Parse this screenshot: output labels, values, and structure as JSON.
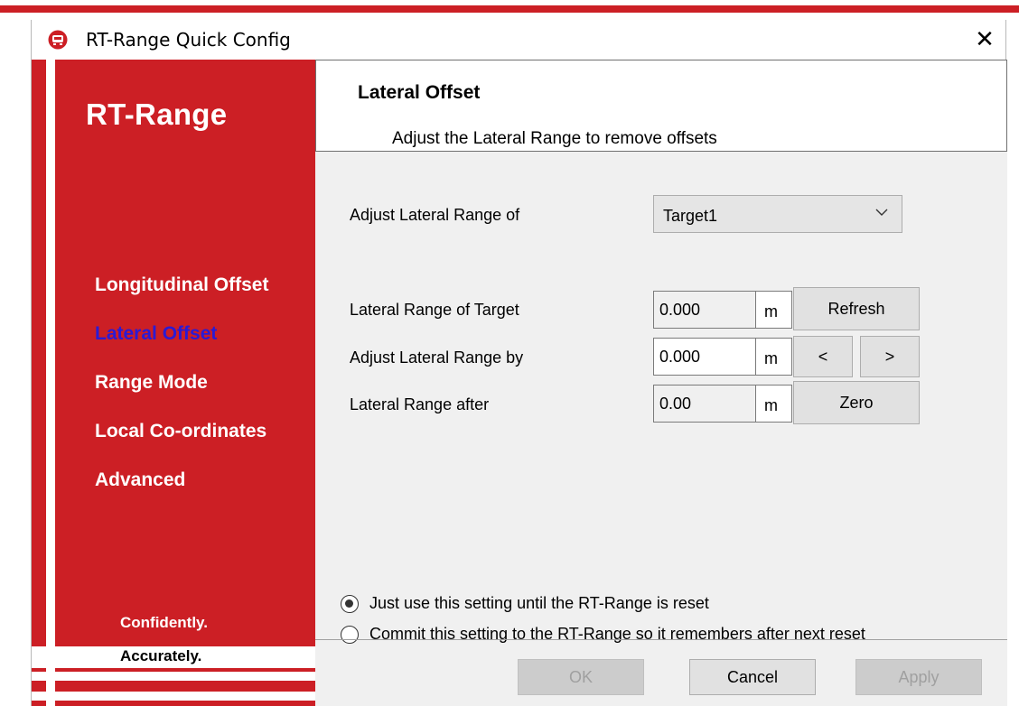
{
  "window": {
    "title": "RT-Range Quick Config",
    "close_glyph": "✕",
    "app_icon": "app-icon",
    "accent_color": "#cc1f25"
  },
  "sidebar": {
    "logo": "RT-Range",
    "items": [
      {
        "label": "Longitudinal Offset",
        "active": false
      },
      {
        "label": "Lateral Offset",
        "active": true
      },
      {
        "label": "Range Mode",
        "active": false
      },
      {
        "label": "Local Co-ordinates",
        "active": false
      },
      {
        "label": "Advanced",
        "active": false
      }
    ],
    "tagline_line1": "Confidently.",
    "tagline_line2": "Accurately.",
    "active_color": "#2b1ad4"
  },
  "header": {
    "title": "Lateral Offset",
    "subtitle": "Adjust the Lateral Range to remove offsets"
  },
  "form": {
    "target_label": "Adjust Lateral Range of",
    "target_value": "Target1",
    "rows": [
      {
        "label": "Lateral Range of Target",
        "value": "0.000",
        "unit": "m"
      },
      {
        "label": "Adjust Lateral Range by",
        "value": "0.000",
        "unit": "m"
      },
      {
        "label": "Lateral Range after",
        "value": "0.00",
        "unit": "m"
      }
    ],
    "refresh_label": "Refresh",
    "decrease_label": "<",
    "increase_label": ">",
    "zero_label": "Zero"
  },
  "options": {
    "radio1": "Just use this setting until the RT-Range is reset",
    "radio2": "Commit this setting to the RT-Range so it remembers after next reset",
    "selected": 0
  },
  "footer": {
    "ok": "OK",
    "cancel": "Cancel",
    "apply": "Apply"
  }
}
